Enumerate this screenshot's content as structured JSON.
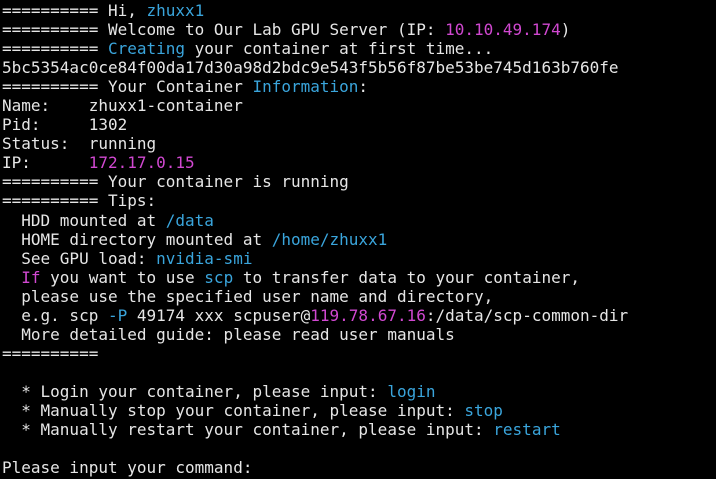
{
  "colors": {
    "background": "#000000",
    "plain": "#e6e6e6",
    "blue": "#3aa5dc",
    "magenta": "#d148d1"
  },
  "terminal": {
    "lines": [
      [
        {
          "t": "========== Hi, ",
          "c": "plain"
        },
        {
          "t": "zhuxx1",
          "c": "blue"
        }
      ],
      [
        {
          "t": "========== Welcome to Our Lab GPU Server (IP: ",
          "c": "plain"
        },
        {
          "t": "10.10.49.174",
          "c": "magenta"
        },
        {
          "t": ")",
          "c": "plain"
        }
      ],
      [
        {
          "t": "========== ",
          "c": "plain"
        },
        {
          "t": "Creating",
          "c": "blue"
        },
        {
          "t": " your container at first time...",
          "c": "plain"
        }
      ],
      [
        {
          "t": "5bc5354ac0ce84f00da17d30a98d2bdc9e543f5b56f87be53be745d163b760fe",
          "c": "plain"
        }
      ],
      [
        {
          "t": "========== Your Container ",
          "c": "plain"
        },
        {
          "t": "Information",
          "c": "blue"
        },
        {
          "t": ":",
          "c": "plain"
        }
      ],
      [
        {
          "t": "Name:    zhuxx1-container",
          "c": "plain"
        }
      ],
      [
        {
          "t": "Pid:     1302",
          "c": "plain"
        }
      ],
      [
        {
          "t": "Status:  running",
          "c": "plain"
        }
      ],
      [
        {
          "t": "IP:      ",
          "c": "plain"
        },
        {
          "t": "172.17.0.15",
          "c": "magenta"
        }
      ],
      [
        {
          "t": "========== Your container is running",
          "c": "plain"
        }
      ],
      [
        {
          "t": "========== Tips:",
          "c": "plain"
        }
      ],
      [
        {
          "t": "  HDD mounted at ",
          "c": "plain"
        },
        {
          "t": "/data",
          "c": "blue"
        }
      ],
      [
        {
          "t": "  HOME directory mounted at ",
          "c": "plain"
        },
        {
          "t": "/home/zhuxx1",
          "c": "blue"
        }
      ],
      [
        {
          "t": "  See GPU load: ",
          "c": "plain"
        },
        {
          "t": "nvidia-smi",
          "c": "blue"
        }
      ],
      [
        {
          "t": "  ",
          "c": "plain"
        },
        {
          "t": "If",
          "c": "magenta"
        },
        {
          "t": " you want to use ",
          "c": "plain"
        },
        {
          "t": "scp",
          "c": "blue"
        },
        {
          "t": " to transfer data to your container,",
          "c": "plain"
        }
      ],
      [
        {
          "t": "  please use the specified user name and directory,",
          "c": "plain"
        }
      ],
      [
        {
          "t": "  e.g. scp ",
          "c": "plain"
        },
        {
          "t": "-P",
          "c": "blue"
        },
        {
          "t": " 49174 xxx scpuser@",
          "c": "plain"
        },
        {
          "t": "119.78.67.16",
          "c": "magenta"
        },
        {
          "t": ":/data/scp-common-dir",
          "c": "plain"
        }
      ],
      [
        {
          "t": "  More detailed guide: please read user manuals",
          "c": "plain"
        }
      ],
      [
        {
          "t": "==========",
          "c": "plain"
        }
      ],
      [],
      [
        {
          "t": "  * Login your container, please input: ",
          "c": "plain"
        },
        {
          "t": "login",
          "c": "blue"
        }
      ],
      [
        {
          "t": "  * Manually stop your container, please input: ",
          "c": "plain"
        },
        {
          "t": "stop",
          "c": "blue"
        }
      ],
      [
        {
          "t": "  * Manually restart your container, please input: ",
          "c": "plain"
        },
        {
          "t": "restart",
          "c": "blue"
        }
      ],
      [],
      [
        {
          "t": "Please input your command: ",
          "c": "plain"
        }
      ]
    ]
  }
}
